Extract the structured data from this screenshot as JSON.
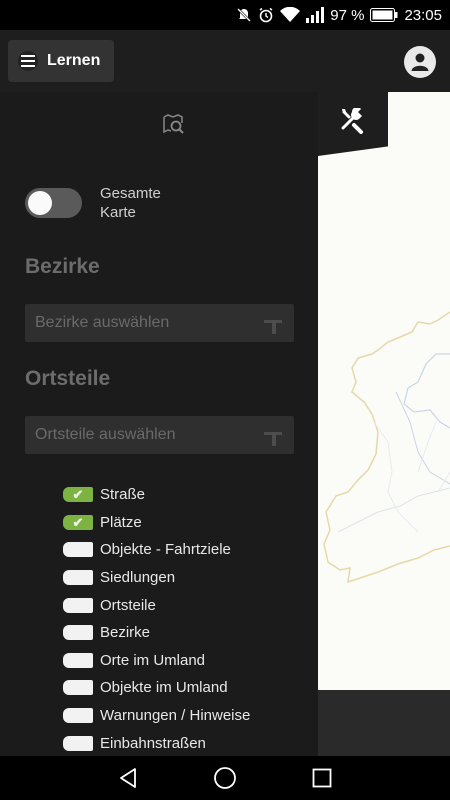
{
  "status_bar": {
    "battery_percent": "97 %",
    "time": "23:05",
    "icons": [
      "mute-icon",
      "alarm-icon",
      "wifi-icon",
      "signal-icon",
      "battery-icon"
    ]
  },
  "app_bar": {
    "menu_label": "Lernen",
    "icons": [
      "hamburger-icon",
      "account-icon"
    ]
  },
  "drawer": {
    "search_icon": "map-search-icon",
    "tools_icon": "tools-icon",
    "toggle": {
      "label": "Gesamte Karte",
      "on": false
    },
    "bezirke": {
      "title": "Bezirke",
      "placeholder": "Bezirke auswählen"
    },
    "ortsteile": {
      "title": "Ortsteile",
      "placeholder": "Ortsteile auswählen"
    },
    "layers": [
      {
        "label": "Straße",
        "checked": true
      },
      {
        "label": "Plätze",
        "checked": true
      },
      {
        "label": "Objekte - Fahrtziele",
        "checked": false
      },
      {
        "label": "Siedlungen",
        "checked": false
      },
      {
        "label": "Ortsteile",
        "checked": false
      },
      {
        "label": "Bezirke",
        "checked": false
      },
      {
        "label": "Orte im Umland",
        "checked": false
      },
      {
        "label": "Objekte im Umland",
        "checked": false
      },
      {
        "label": "Warnungen / Hinweise",
        "checked": false
      },
      {
        "label": "Einbahnstraßen",
        "checked": false
      }
    ],
    "check_glyph": "✔"
  },
  "colors": {
    "checked": "#7cb342",
    "drawer_bg": "#1b1b1b",
    "map_bg": "#fbfbf8",
    "map_boundary": "#e6d9a8"
  },
  "nav_bar": {
    "icons": [
      "back-icon",
      "home-icon",
      "recents-icon"
    ]
  }
}
